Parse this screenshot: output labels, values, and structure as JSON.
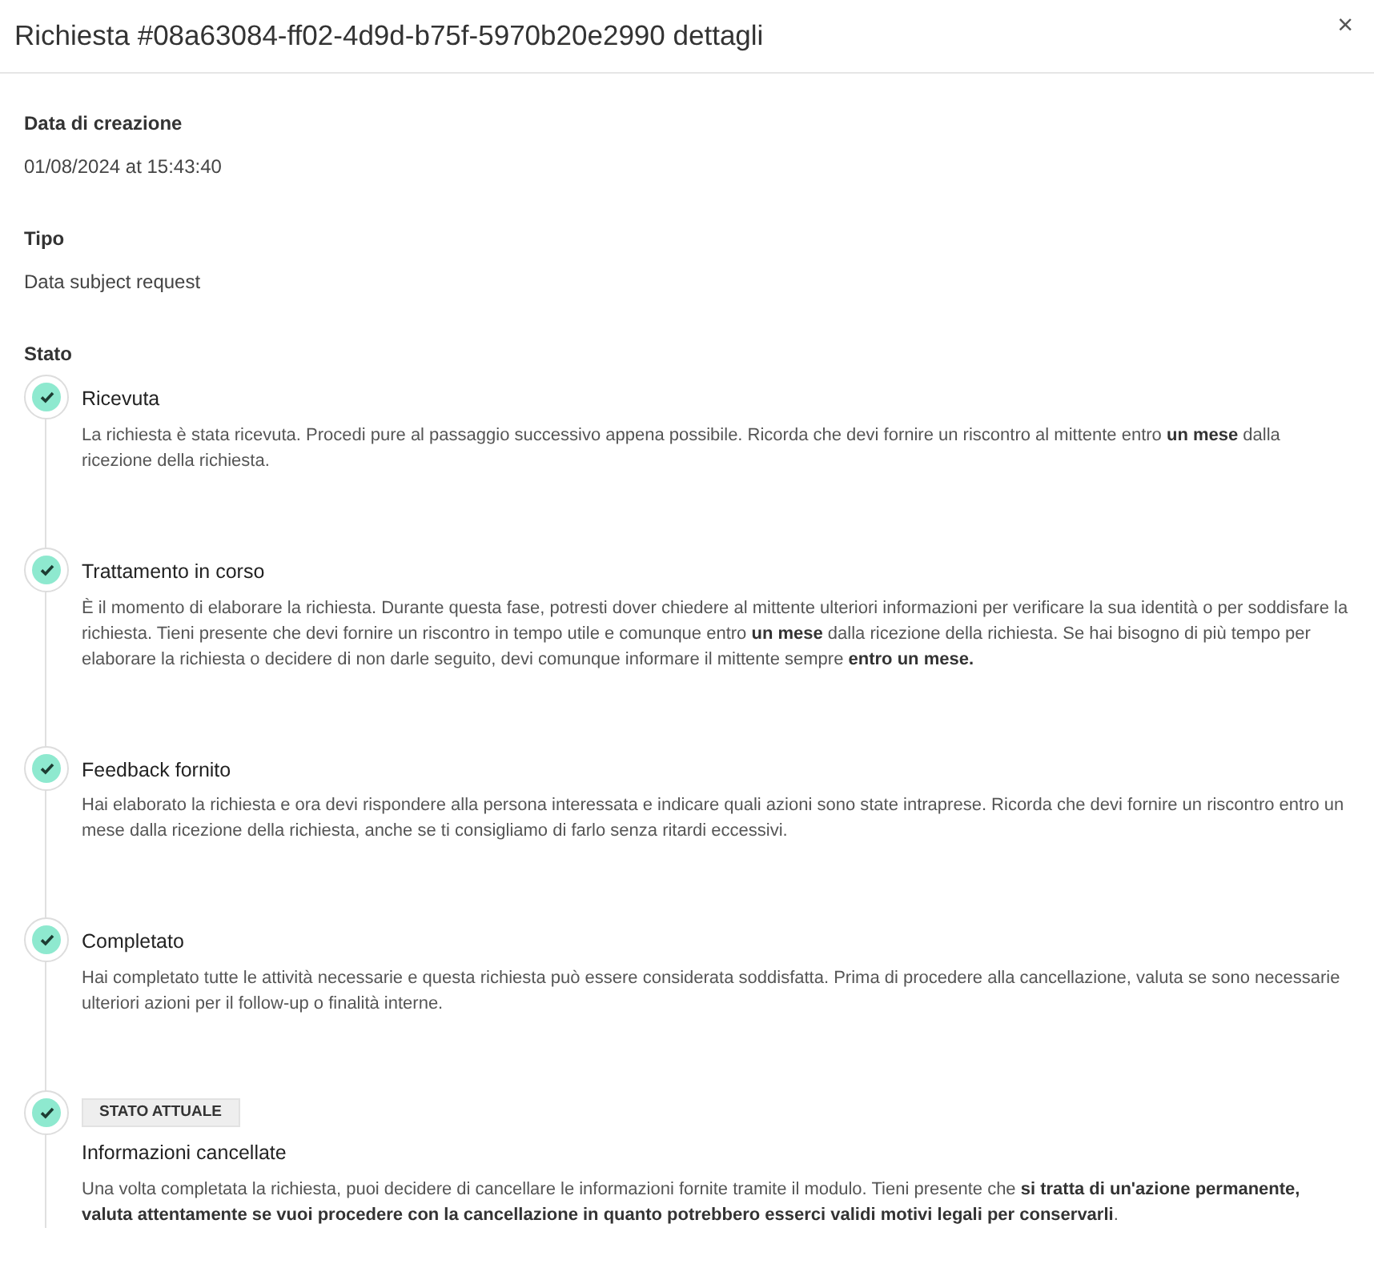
{
  "modal": {
    "title": "Richiesta #08a63084-ff02-4d9d-b75f-5970b20e2990 dettagli",
    "close": "×"
  },
  "fields": [
    {
      "label": "Data di creazione",
      "value": "01/08/2024 at 15:43:40"
    },
    {
      "label": "Tipo",
      "value": "Data subject request"
    }
  ],
  "status": {
    "label": "Stato",
    "steps": [
      {
        "title": "Ricevuta",
        "done": true,
        "description": "La richiesta è stata ricevuta. Procedi pure al passaggio successivo appena possibile. Ricorda che devi fornire un riscontro al mittente entro **un mese** dalla ricezione della richiesta."
      },
      {
        "title": "Trattamento in corso",
        "done": true,
        "description": "È il momento di elaborare la richiesta. Durante questa fase, potresti dover chiedere al mittente ulteriori informazioni per verificare la sua identità o per soddisfare la richiesta. Tieni presente che devi fornire un riscontro in tempo utile e comunque entro **un mese** dalla ricezione della richiesta. Se hai bisogno di più tempo per elaborare la richiesta o decidere di non darle seguito, devi comunque informare il mittente sempre **entro un mese.**"
      },
      {
        "title": "Feedback fornito",
        "done": true,
        "description": "Hai elaborato la richiesta e ora devi rispondere alla persona interessata e indicare quali azioni sono state intraprese. Ricorda che devi fornire un riscontro entro un mese dalla ricezione della richiesta, anche se ti consigliamo di farlo senza ritardi eccessivi."
      },
      {
        "title": "Completato",
        "done": true,
        "description": "Hai completato tutte le attività necessarie e questa richiesta può essere considerata soddisfatta. Prima di procedere alla cancellazione, valuta se sono necessarie ulteriori azioni per il follow-up o finalità interne."
      },
      {
        "title": "Informazioni cancellate",
        "done": true,
        "badge": "STATO ATTUALE",
        "description": "Una volta completata la richiesta, puoi decidere di cancellare le informazioni fornite tramite il modulo. Tieni presente che **si tratta di un'azione permanente, valuta attentamente se vuoi procedere con la cancellazione in quanto potrebbero esserci validi motivi legali per conservarli**."
      }
    ]
  }
}
